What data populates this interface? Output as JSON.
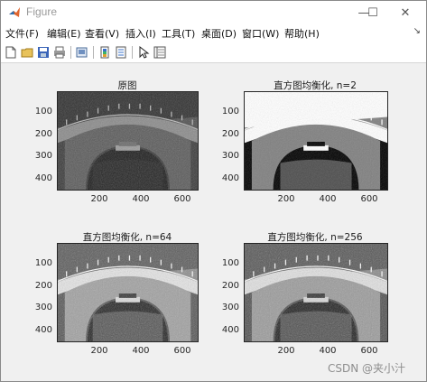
{
  "window": {
    "title": "Figure"
  },
  "window_controls": {
    "minimize": "—",
    "maximize": "☐",
    "close": "✕"
  },
  "menu": [
    {
      "label": "文件(F)"
    },
    {
      "label": "编辑(E)"
    },
    {
      "label": "查看(V)"
    },
    {
      "label": "插入(I)"
    },
    {
      "label": "工具(T)"
    },
    {
      "label": "桌面(D)"
    },
    {
      "label": "窗口(W)"
    },
    {
      "label": "帮助(H)"
    }
  ],
  "menu_overflow": "↘",
  "toolbar": [
    {
      "icon": "new-figure-icon"
    },
    {
      "icon": "open-file-icon"
    },
    {
      "icon": "save-icon"
    },
    {
      "icon": "print-icon"
    },
    {
      "icon": "link-figure-icon"
    },
    {
      "icon": "insert-colorbar-icon"
    },
    {
      "icon": "edit-plot-icon"
    },
    {
      "icon": "property-inspector-icon"
    }
  ],
  "plots": [
    {
      "title": "原图",
      "yticks": [
        "100",
        "200",
        "300",
        "400"
      ],
      "xticks": [
        "200",
        "400",
        "600"
      ]
    },
    {
      "title": "直方图均衡化, n=2",
      "yticks": [
        "100",
        "200",
        "300",
        "400"
      ],
      "xticks": [
        "200",
        "400",
        "600"
      ]
    },
    {
      "title": "直方图均衡化, n=64",
      "yticks": [
        "100",
        "200",
        "300",
        "400"
      ],
      "xticks": [
        "200",
        "400",
        "600"
      ]
    },
    {
      "title": "直方图均衡化, n=256",
      "yticks": [
        "100",
        "200",
        "300",
        "400"
      ],
      "xticks": [
        "200",
        "400",
        "600"
      ]
    }
  ],
  "watermark": "CSDN @夹小汁"
}
